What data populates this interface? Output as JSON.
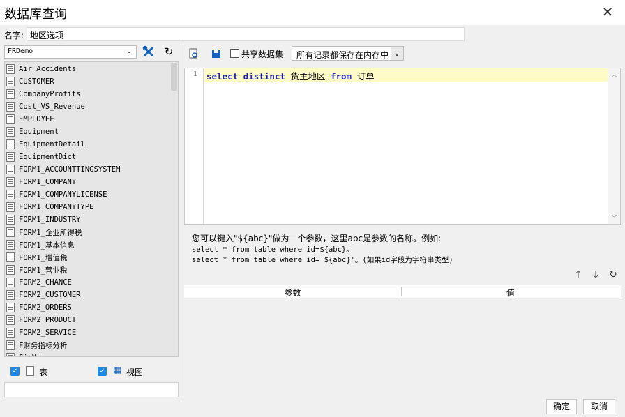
{
  "window": {
    "title": "数据库查询",
    "close_icon": "close-icon"
  },
  "name_field": {
    "label": "名字:",
    "value": "地区选项"
  },
  "left": {
    "connection": "FRDemo",
    "tables": [
      "Air_Accidents",
      "CUSTOMER",
      "CompanyProfits",
      "Cost_VS_Revenue",
      "EMPLOYEE",
      "Equipment",
      "EquipmentDetail",
      "EquipmentDict",
      "FORM1_ACCOUNTTINGSYSTEM",
      "FORM1_COMPANY",
      "FORM1_COMPANYLICENSE",
      "FORM1_COMPANYTYPE",
      "FORM1_INDUSTRY",
      "FORM1_企业所得税",
      "FORM1_基本信息",
      "FORM1_增值税",
      "FORM1_营业税",
      "FORM2_CHANCE",
      "FORM2_CUSTOMER",
      "FORM2_ORDERS",
      "FORM2_PRODUCT",
      "FORM2_SERVICE",
      "F财务指标分析",
      "GisMap"
    ],
    "filter_table_label": "表",
    "filter_view_label": "视图"
  },
  "toolbar": {
    "share_label": "共享数据集",
    "memory_option": "所有记录都保存在内存中"
  },
  "editor": {
    "line_number": "1",
    "kw_select": "select",
    "kw_distinct": "distinct",
    "field": "货主地区",
    "kw_from": "from",
    "table": "订单"
  },
  "help": {
    "line1": "您可以键入\"${abc}\"做为一个参数，这里abc是参数的名称。例如:",
    "line2": "select * from table where id=${abc}。",
    "line3": "select * from table where id='${abc}'。(如果id字段为字符串类型)"
  },
  "params": {
    "col_param": "参数",
    "col_value": "值"
  },
  "buttons": {
    "ok": "确定",
    "cancel": "取消"
  }
}
